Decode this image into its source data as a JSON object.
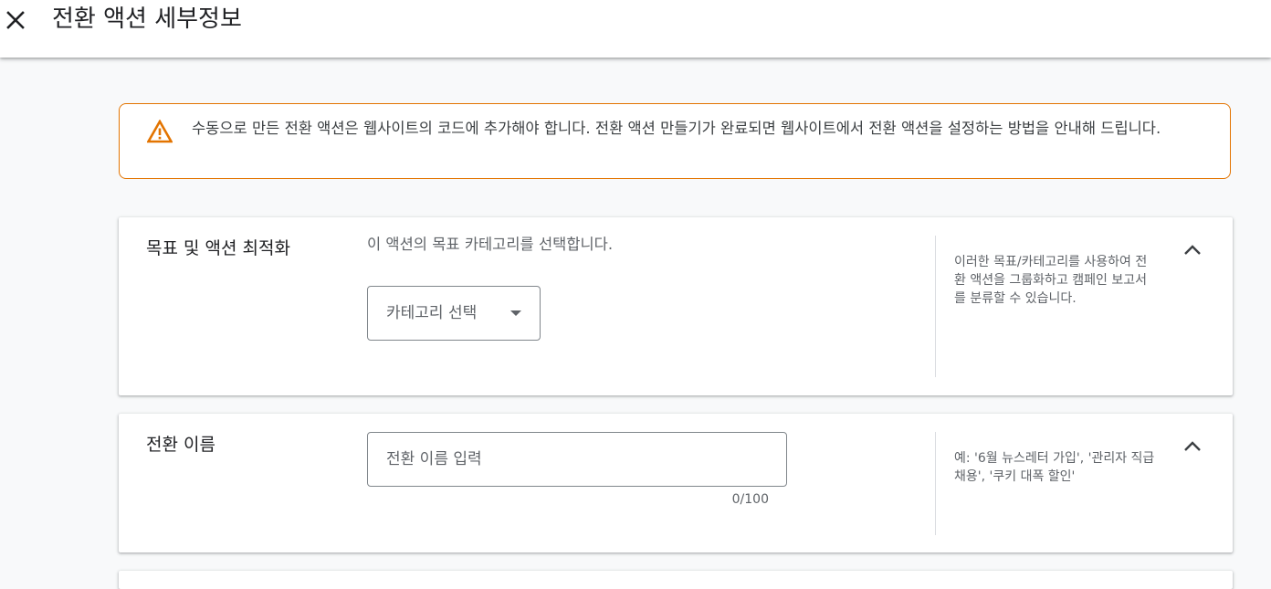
{
  "header": {
    "close_icon": "close-icon",
    "title": "전환 액션 세부정보"
  },
  "warning": {
    "icon": "warning-icon",
    "color": "#e37400",
    "text": "수동으로 만든 전환 액션은 웹사이트의 코드에 추가해야 합니다. 전환 액션 만들기가 완료되면 웹사이트에서 전환 액션을 설정하는 방법을 안내해 드립니다."
  },
  "sections": {
    "goal": {
      "title": "목표 및 액션 최적화",
      "description": "이 액션의 목표 카테고리를 선택합니다.",
      "select_label": "카테고리 선택",
      "help": "이러한 목표/카테고리를 사용하여 전환 액션을 그룹화하고 캠페인 보고서를 분류할 수 있습니다.",
      "collapse_icon": "chevron-up-icon"
    },
    "name": {
      "title": "전환 이름",
      "input_value": "",
      "input_placeholder": "전환 이름 입력",
      "counter": "0/100",
      "help": "예: '6월 뉴스레터 가입', '관리자 직급 채용', '쿠키 대폭 할인'",
      "collapse_icon": "chevron-up-icon"
    }
  }
}
